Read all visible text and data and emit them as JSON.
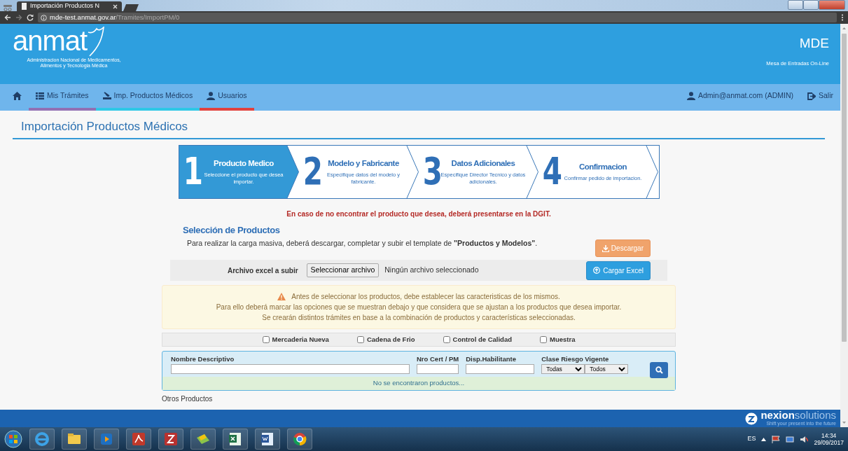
{
  "browser": {
    "tab_title": "Importación Productos N",
    "url_host": "mde-test.anmat.gov.ar",
    "url_path": "/Tramites/ImportPM/0"
  },
  "header": {
    "logo_text": "anmat",
    "logo_subtitle": [
      "Administracion Nacional de Medicamentos,",
      "Alimentos y Tecnologia Médica"
    ],
    "app_title": "MDE",
    "app_subtitle": "Mesa de Entradas On-Line"
  },
  "nav": {
    "items": [
      {
        "label": "Mis Trámites",
        "kind": "list",
        "color": "#9270b3"
      },
      {
        "label": "Imp. Productos Médicos",
        "kind": "import",
        "color": "#2ec8e6"
      },
      {
        "label": "Usuarios",
        "kind": "user",
        "color": "#e2423e"
      }
    ],
    "user": "Admin@anmat.com (ADMIN)",
    "logout": "Salir"
  },
  "page_title": "Importación Productos Médicos",
  "steps": [
    {
      "number": "1",
      "title": "Producto Medico",
      "description": "Seleccione el producto que desea importar.",
      "selected": true
    },
    {
      "number": "2",
      "title": "Modelo y Fabricante",
      "description": "Especifique datos del modelo y fabricante.",
      "selected": false
    },
    {
      "number": "3",
      "title": "Datos Adicionales",
      "description": "Especifique Director Tecnico y datos adicionales.",
      "selected": false
    },
    {
      "number": "4",
      "title": "Confirmacion",
      "description": "Confirmar pedido de importacion.",
      "selected": false
    }
  ],
  "notice": "En caso de no encontrar el producto que desea, deberá presentarse en la DGIT.",
  "selection": {
    "title": "Selección de Productos",
    "instructions": "Para realizar la carga masiva, deberá descargar, completar y subir el template de **\"Productos y Modelos\"**.",
    "download_button": "Descargar",
    "file_label": "Archivo excel a subir",
    "file_button": "Seleccionar archivo",
    "file_status": "Ningún archivo seleccionado",
    "upload_button": "Cargar Excel"
  },
  "warning": [
    "Antes de seleccionar los productos, debe establecer las caracteristicas de los mismos.",
    "Para ello deberá marcar las opciones que se muestran debajo y que considera que se ajustan a los productos que desea importar.",
    "Se crearán distintos trámites en base a la combinación de productos y características seleccionadas."
  ],
  "options": [
    {
      "label": "Mercaderia Nueva",
      "checked": false
    },
    {
      "label": "Cadena de Frio",
      "checked": false
    },
    {
      "label": "Control de Calidad",
      "checked": false
    },
    {
      "label": "Muestra",
      "checked": false
    }
  ],
  "search": {
    "fields": [
      {
        "label": "Nombre Descriptivo",
        "kind": "text"
      },
      {
        "label": "Nro Cert / PM",
        "kind": "text"
      },
      {
        "label": "Disp.Habilitante",
        "kind": "text"
      },
      {
        "label": "Clase Riesgo",
        "kind": "select",
        "value": "Todas"
      },
      {
        "label": "Vigente",
        "kind": "select",
        "value": "Todos"
      }
    ],
    "empty_message": "No se encontraron productos..."
  },
  "other_title": "Otros Productos",
  "footer": {
    "brand": "**nexion**solutions",
    "tagline": "Shift your present into the future"
  },
  "taskbar": {
    "language": "ES",
    "time": "14:34",
    "date": "29/09/2017"
  }
}
